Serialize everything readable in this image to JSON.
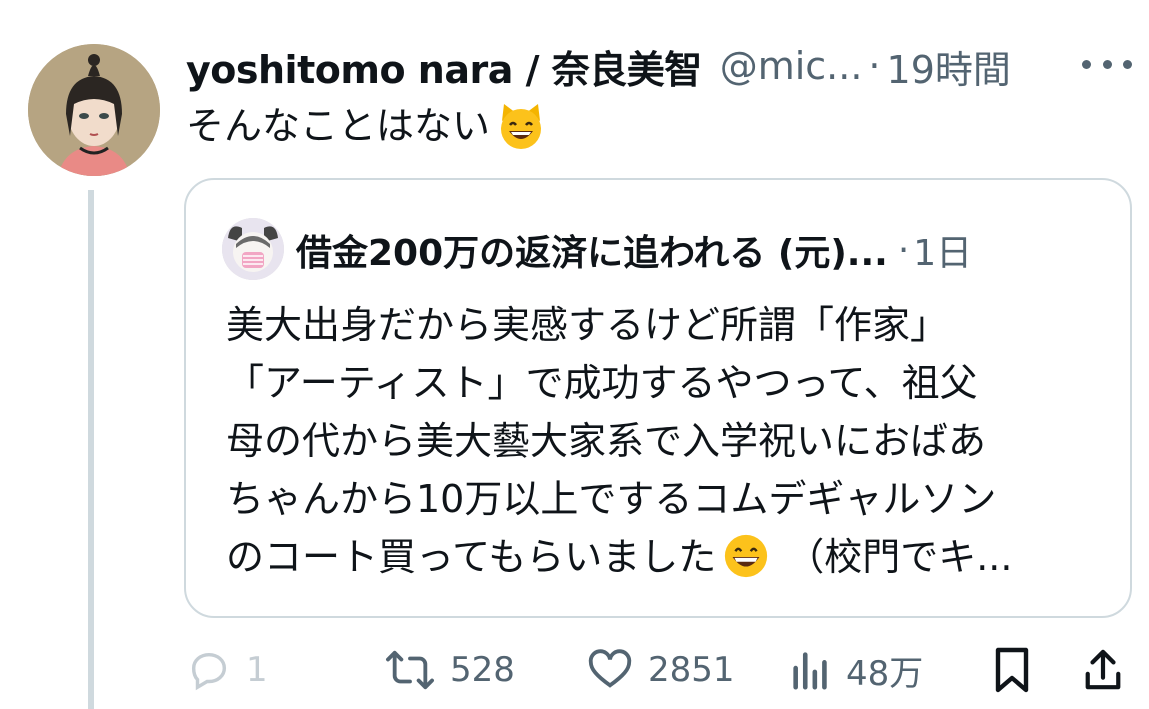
{
  "tweet": {
    "author_name": "yoshitomo nara / 奈良美智",
    "handle": "@mic...",
    "separator": "·",
    "time": "19時間",
    "text": "そんなことはない",
    "emoji": "grinning-cat-emoji"
  },
  "quote": {
    "author_name": "借金200万の返済に追われる (元)...",
    "separator": "·",
    "time": "1日",
    "lines": [
      "美大出身だから実感するけど所謂「作家」",
      "「アーティスト」で成功するやつって、祖父",
      "母の代から美大藝大家系で入学祝いにおばあ",
      "ちゃんから10万以上でするコムデギャルソン",
      "のコート買ってもらいました",
      "（校門でキ..."
    ],
    "emoji": "grinning-face-emoji"
  },
  "actions": {
    "reply_count": "1",
    "retweet_count": "528",
    "like_count": "2851",
    "views_count": "48万"
  },
  "colors": {
    "text": "#0f1419",
    "secondary": "#536471",
    "border": "#cfd9de",
    "faint": "#c5cdd3"
  }
}
